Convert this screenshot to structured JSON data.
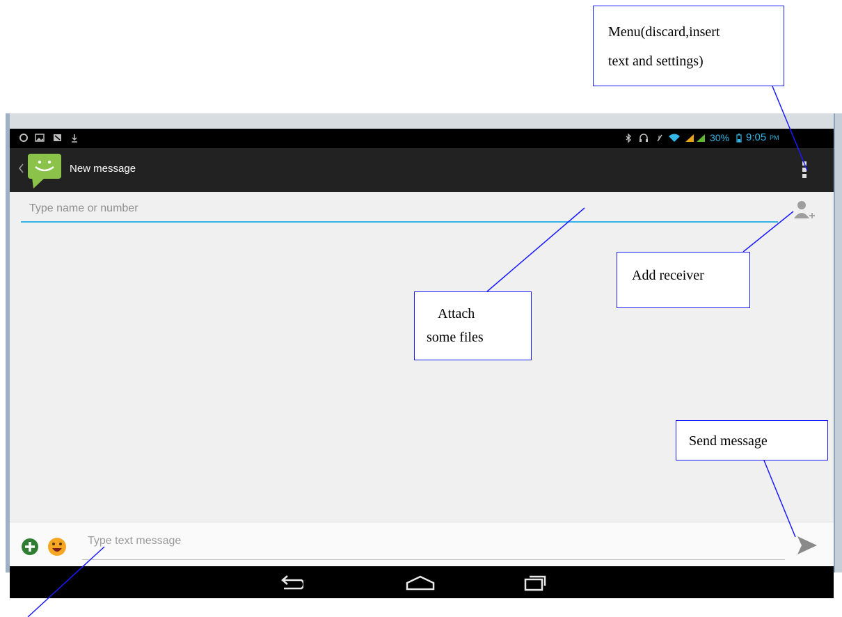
{
  "status_bar": {
    "battery_percent": "30%",
    "time": "9:05",
    "time_suffix": "PM",
    "left_icons": [
      "globe-icon",
      "image-icon",
      "notification-icon",
      "download-icon"
    ],
    "right_icons": [
      "bluetooth-icon",
      "headset-icon",
      "mute-icon",
      "wifi-icon",
      "signal-icon",
      "signal-icon",
      "battery-icon"
    ],
    "accent": "#33b5e5",
    "signal_color": "#e8a317"
  },
  "action_bar": {
    "title": "New message",
    "app_icon": "messaging-smiley-icon",
    "overflow_icon": "overflow-menu-icon",
    "app_icon_color": "#8bc34a"
  },
  "recipient": {
    "placeholder": "Type name or number",
    "add_icon": "add-contact-icon"
  },
  "compose": {
    "placeholder": "Type text message",
    "attach_icon": "plus-icon",
    "emoji_icon": "smiley-icon",
    "send_icon": "send-icon",
    "attach_color": "#2e7d32",
    "emoji_color": "#f5a623"
  },
  "nav_bar": {
    "icons": [
      "back-icon",
      "home-icon",
      "recents-icon"
    ]
  },
  "callouts": {
    "menu": "Menu(discard,insert text and settings)",
    "menu_line1": "Menu(discard,insert",
    "menu_line2": "text and settings)",
    "attach": "Attach some files",
    "attach_line1": "Attach",
    "attach_line2": "some files",
    "add_receiver": "Add receiver",
    "send_message": "Send message"
  },
  "callout_line_color": "#1a1aff"
}
